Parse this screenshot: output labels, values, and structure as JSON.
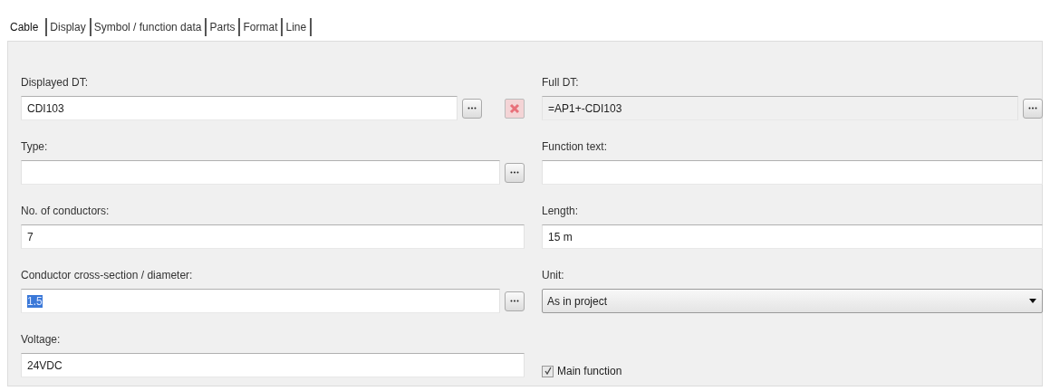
{
  "tabs": [
    {
      "label": "Cable",
      "selected": true
    },
    {
      "label": "Display",
      "selected": false
    },
    {
      "label": "Symbol / function data",
      "selected": false
    },
    {
      "label": "Parts",
      "selected": false
    },
    {
      "label": "Format",
      "selected": false
    },
    {
      "label": "Line",
      "selected": false
    }
  ],
  "rows": [
    [
      {
        "kind": "text",
        "label": "Displayed DT:",
        "value": "CDI103",
        "browse": true,
        "delete": true
      },
      {
        "kind": "text",
        "label": "Full DT:",
        "value": "=AP1+-CDI103",
        "readonly": true,
        "browse": true
      }
    ],
    [
      {
        "kind": "text",
        "label": "Type:",
        "browse": true
      },
      {
        "kind": "text",
        "label": "Function text:"
      }
    ],
    [
      {
        "kind": "text",
        "label": "No. of conductors:",
        "value": "7"
      },
      {
        "kind": "text",
        "label": "Length:",
        "value": "15 m"
      }
    ],
    [
      {
        "kind": "text",
        "label": "Conductor cross-section / diameter:",
        "value": "1.5",
        "highlighted": true,
        "browse": true
      },
      {
        "kind": "select",
        "label": "Unit:",
        "value": "As in project"
      }
    ],
    [
      {
        "kind": "text",
        "label": "Voltage:",
        "value": "24VDC"
      },
      {
        "kind": "checkbox",
        "label": "Main function",
        "checked": true
      }
    ]
  ]
}
